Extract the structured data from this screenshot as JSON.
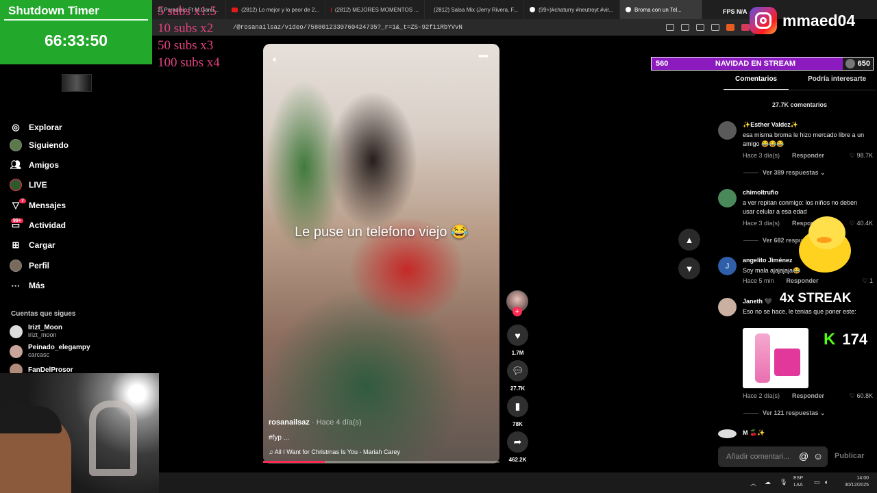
{
  "browser": {
    "tabs": [
      {
        "label": "2) Paradisio Ft M.Garci...",
        "icon": "none"
      },
      {
        "label": "(2812) Lo mejor y lo peor de 2...",
        "icon": "youtube"
      },
      {
        "label": "(2812) MEJORES MOMENTOS ...",
        "icon": "youtube"
      },
      {
        "label": "(2812) Salsa Mix (Jerry Rivera, F...",
        "icon": "youtube"
      },
      {
        "label": "(99+)#chaturry #neutroyt #vir...",
        "icon": "tiktok"
      },
      {
        "label": "Broma con un Tel...",
        "icon": "tiktok"
      }
    ],
    "url": "/@rosanailsaz/video/7588012330760424735?_r=1&_t=ZS-92f11RbYVvN"
  },
  "overlay": {
    "timer_title": "Shutdown Timer",
    "timer_value": "66:33:50",
    "subs": [
      "5 subs x1.5",
      "10 subs x2",
      "50 subs x3",
      "100 subs x4"
    ],
    "instagram_handle": "mmaed04",
    "fps_label": "FPS N/A",
    "goal": {
      "left": "560",
      "title": "NAVIDAD EN STREAM",
      "right": "650"
    },
    "streak": "4x STREAK",
    "kick_count": "174"
  },
  "sidebar": {
    "items": [
      {
        "label": "Explorar",
        "icon": "compass-icon"
      },
      {
        "label": "Siguiendo",
        "icon": "following-avatar-icon"
      },
      {
        "label": "Amigos",
        "icon": "friends-icon"
      },
      {
        "label": "LIVE",
        "icon": "live-icon"
      },
      {
        "label": "Mensajes",
        "icon": "messages-icon",
        "badge": "7"
      },
      {
        "label": "Actividad",
        "icon": "activity-icon",
        "badge": "99+"
      },
      {
        "label": "Cargar",
        "icon": "upload-icon"
      },
      {
        "label": "Perfil",
        "icon": "profile-icon"
      },
      {
        "label": "Más",
        "icon": "more-icon"
      }
    ],
    "following_heading": "Cuentas que sigues",
    "accounts": [
      {
        "name": "Irizt_Moon",
        "username": "irizt_moon"
      },
      {
        "name": "Peinado_elegampy",
        "username": "carcasc"
      },
      {
        "name": "FanDelProsor",
        "username": ""
      }
    ]
  },
  "video": {
    "caption": "Le puse un telefono viejo 😂",
    "author": "rosanailsaz",
    "date": " · Hace 4 día(s)",
    "tags": "#fyp ...",
    "song": "♫  All I Want for Christmas Is You - Mariah Carey",
    "progress": 0.26
  },
  "actions": {
    "likes": "1.7M",
    "comments": "27.7K",
    "saves": "78K",
    "shares": "462.2K"
  },
  "panel": {
    "tab_comments": "Comentarios",
    "tab_interest": "Podría interesarte",
    "comment_count": "27.7K comentarios",
    "comments": [
      {
        "name": "✨Esther Valdez✨",
        "text": "esa misma broma le hizo mercado libre a un amigo 😂😂😂",
        "time": "Hace 3 día(s)",
        "reply": "Responder",
        "likes": "♡ 98.7K",
        "replies": "Ver 389 respuestas ⌄"
      },
      {
        "name": "chimoltrufio",
        "text": "a ver repitan conmigo: los niños no deben usar celular a esa edad",
        "time": "Hace 3 día(s)",
        "reply": "Responder",
        "likes": "♡ 40.4K",
        "replies": "Ver 682 respuestas ⌄"
      },
      {
        "name": "angelito Jiménez",
        "text": "Soy mala ajajajaja😂",
        "time": "Hace 5 min",
        "reply": "Responder",
        "likes": "♡ 1",
        "replies": ""
      },
      {
        "name": "Janeth 🖤",
        "text": "Eso no se hace, le tenias que poner este:",
        "time": "Hace 2 día(s)",
        "reply": "Responder",
        "likes": "♡ 60.8K",
        "replies": "Ver 121 respuestas ⌄"
      },
      {
        "name": "M 🍒✨",
        "text": "",
        "time": "",
        "reply": "",
        "likes": "",
        "replies": ""
      }
    ],
    "avatar_initial_j": "J",
    "input_placeholder": "Añadir comentari...",
    "post_label": "Publicar"
  },
  "taskbar": {
    "lang": "ESP\nLAA",
    "time": "14:00",
    "date": "30/12/2025"
  }
}
